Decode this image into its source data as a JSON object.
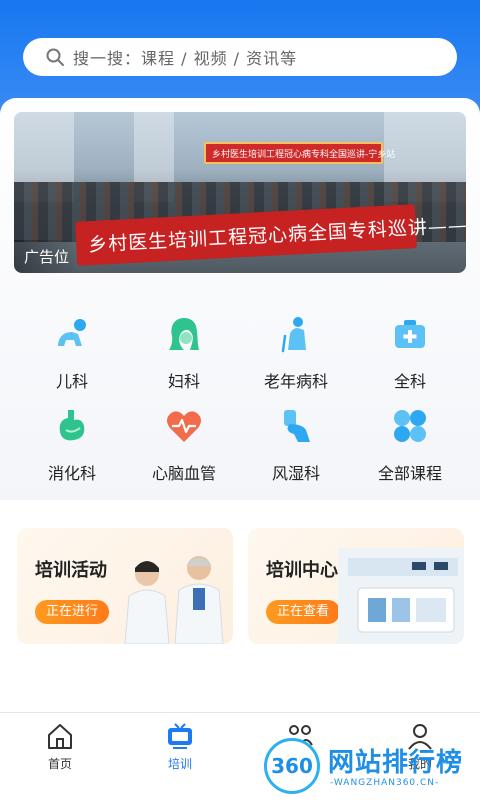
{
  "search": {
    "placeholder": "搜一搜：课程 / 视频 / 资讯等"
  },
  "banner": {
    "sign_text": "乡村医生培训工程冠心病专科全国巡讲-宁乡站",
    "red_banner_text": "乡村医生培训工程冠心病全国专科巡讲——宁乡站",
    "ad_label": "广告位"
  },
  "categories": [
    {
      "label": "儿科",
      "icon": "baby-crawl-icon",
      "color": "#2ea8f0"
    },
    {
      "label": "妇科",
      "icon": "woman-face-icon",
      "color": "#2fc48d"
    },
    {
      "label": "老年病科",
      "icon": "elderly-icon",
      "color": "#2ea8f0"
    },
    {
      "label": "全科",
      "icon": "medical-kit-icon",
      "color": "#2ea8f0"
    },
    {
      "label": "消化科",
      "icon": "stomach-icon",
      "color": "#2fc48d"
    },
    {
      "label": "心脑血管",
      "icon": "heart-pulse-icon",
      "color": "#f26b4b"
    },
    {
      "label": "风湿科",
      "icon": "joint-icon",
      "color": "#2ea8f0"
    },
    {
      "label": "全部课程",
      "icon": "all-grid-icon",
      "color": "#2ea8f0"
    }
  ],
  "cards": [
    {
      "title": "培训活动",
      "button": "正在进行"
    },
    {
      "title": "培训中心",
      "button": "正在查看"
    }
  ],
  "tabbar": [
    {
      "label": "首页",
      "icon": "home-icon",
      "active": false
    },
    {
      "label": "培训",
      "icon": "training-tv-icon",
      "active": true
    },
    {
      "label": "",
      "icon": "community-icon",
      "active": false
    },
    {
      "label": "我的",
      "icon": "profile-icon",
      "active": false
    }
  ],
  "watermark": {
    "circle": "360",
    "title": "网站排行榜",
    "url": "-WANGZHAN360.CN-"
  },
  "colors": {
    "primary": "#1677f0",
    "accent": "#ff8a1f"
  }
}
